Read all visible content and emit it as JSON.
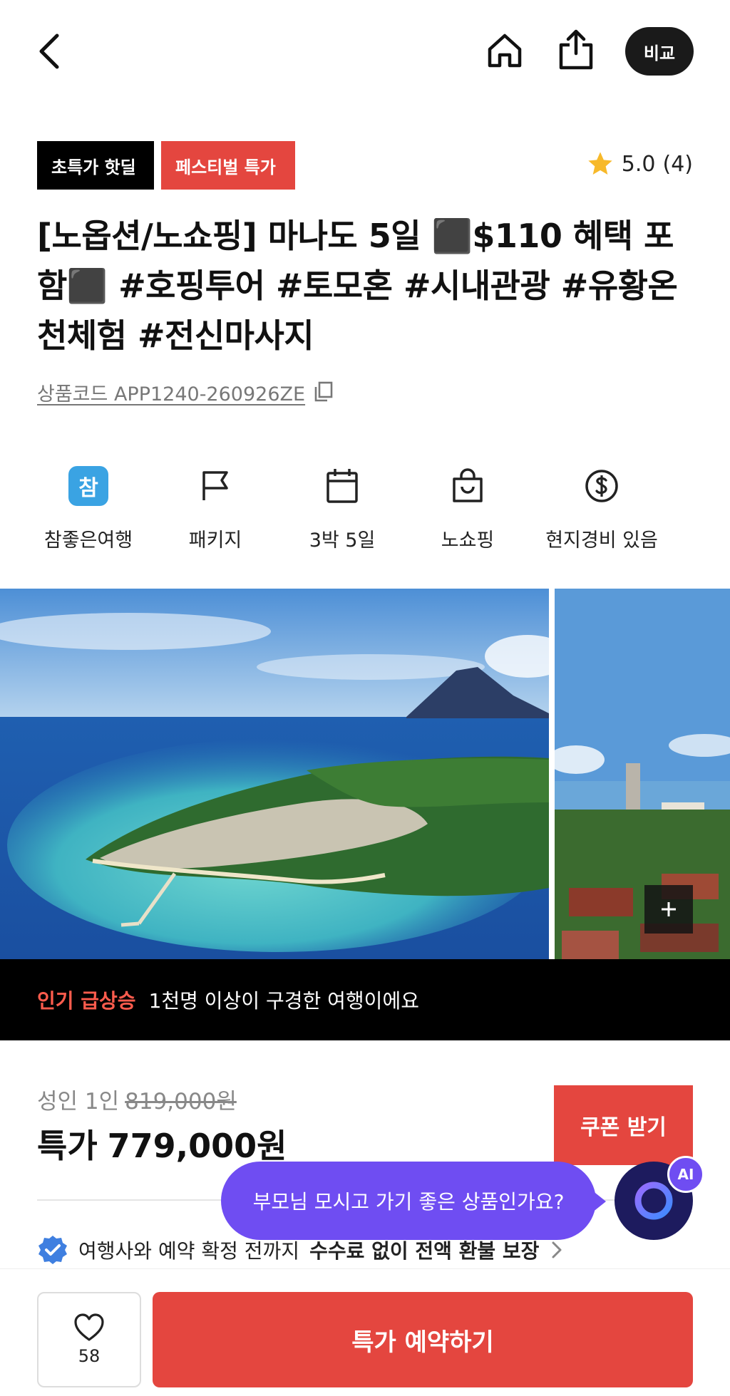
{
  "header": {
    "compare_label": "비교"
  },
  "badges": {
    "hot_deal": "초특가 핫딜",
    "festival": "페스티벌 특가"
  },
  "rating": {
    "score": "5.0",
    "count": "(4)"
  },
  "product": {
    "title": "[노옵션/노쇼핑] 마나도 5일 ⬛$110 혜택 포함⬛ #호핑투어 #토모혼 #시내관광 #유황온천체험 #전신마사지",
    "code": "상품코드 APP1240-260926ZE"
  },
  "info": [
    {
      "label": "참좋은여행",
      "icon": "agency-logo-icon",
      "logo_text": "참"
    },
    {
      "label": "패키지",
      "icon": "flag-icon"
    },
    {
      "label": "3박 5일",
      "icon": "calendar-icon"
    },
    {
      "label": "노쇼핑",
      "icon": "shopping-bag-icon"
    },
    {
      "label": "현지경비 있음",
      "icon": "dollar-icon"
    }
  ],
  "banner": {
    "tag": "인기 급상승",
    "text": "1천명 이상이 구경한 여행이에요"
  },
  "price": {
    "label": "성인 1인",
    "original": "819,000원",
    "special_label": "특가",
    "special": "779,000원",
    "coupon_label": "쿠폰 받기"
  },
  "refund": {
    "prefix": "여행사와 예약 확정 전까지",
    "strong": "수수료 없이 전액 환불 보장"
  },
  "ai": {
    "question": "부모님 모시고 가기 좋은 상품인가요?",
    "badge": "AI"
  },
  "bottom": {
    "like_count": "58",
    "book_label": "특가 예약하기"
  },
  "colors": {
    "accent_red": "#e4463f",
    "ai_purple": "#6f4df2",
    "banner_tag": "#ff5c4d"
  }
}
